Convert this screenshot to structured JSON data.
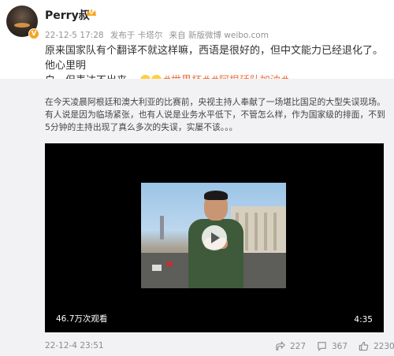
{
  "post": {
    "username": "Perry叔",
    "meta_date": "22-12-5 17:28",
    "meta_location": "发布于 卡塔尔",
    "meta_source": "来自 新版微博 weibo.com",
    "text_line1": "原来国家队有个翻译不就这样嘛，西语是很好的，但中文能力已经退化了。他心里明",
    "text_line2": "白，但表达不出来。",
    "tag1": "#世界杯#",
    "tag2": "#阿根廷队加油#"
  },
  "repost": {
    "text": "在今天凌晨阿根廷和澳大利亚的比赛前，央视主持人奉献了一场堪比国足的大型失误现场。有人说是因为临场紧张，也有人说是业务水平低下，不管怎么样，作为国家级的排面，不到5分钟的主持出现了真么多次的失误，实屡不该。。。",
    "video": {
      "views": "46.7万次观看",
      "duration": "4:35"
    },
    "timestamp": "22-12-4 23:51",
    "share_count": "227",
    "comment_count": "367",
    "like_count": "2230"
  },
  "colors": {
    "tag": "#eb7340",
    "repost_bg": "#f2f2f5",
    "video_bg": "#000000",
    "badge": "#f5a623"
  },
  "icons": [
    "crown-icon",
    "verified-badge-icon",
    "play-icon",
    "share-icon",
    "comment-icon",
    "like-icon",
    "emoji-icon"
  ]
}
